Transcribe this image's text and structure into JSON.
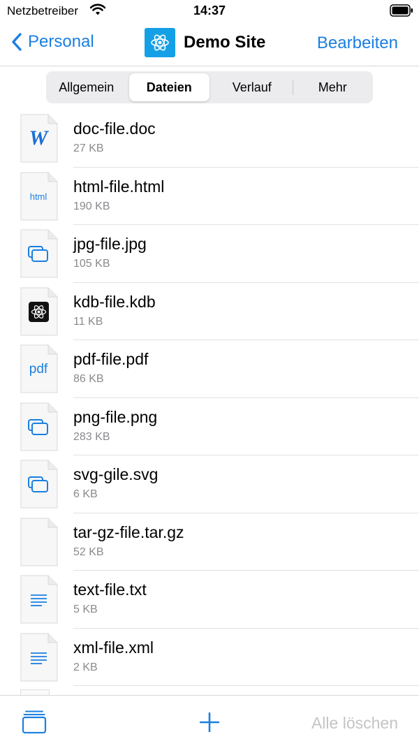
{
  "status_bar": {
    "carrier": "Netzbetreiber",
    "time": "14:37"
  },
  "nav": {
    "back_label": "Personal",
    "title": "Demo Site",
    "edit_label": "Bearbeiten"
  },
  "tabs": [
    {
      "label": "Allgemein",
      "selected": false
    },
    {
      "label": "Dateien",
      "selected": true
    },
    {
      "label": "Verlauf",
      "selected": false
    },
    {
      "label": "Mehr",
      "selected": false
    }
  ],
  "files": [
    {
      "name": "doc-file.doc",
      "size": "27 KB",
      "icon": "word-doc-icon"
    },
    {
      "name": "html-file.html",
      "size": "190 KB",
      "icon": "html-file-icon",
      "icon_text": "html"
    },
    {
      "name": "jpg-file.jpg",
      "size": "105 KB",
      "icon": "image-file-icon"
    },
    {
      "name": "kdb-file.kdb",
      "size": "11 KB",
      "icon": "kdb-file-icon"
    },
    {
      "name": "pdf-file.pdf",
      "size": "86 KB",
      "icon": "pdf-file-icon",
      "icon_text": "pdf"
    },
    {
      "name": "png-file.png",
      "size": "283 KB",
      "icon": "image-file-icon"
    },
    {
      "name": "svg-gile.svg",
      "size": "6 KB",
      "icon": "image-file-icon"
    },
    {
      "name": "tar-gz-file.tar.gz",
      "size": "52 KB",
      "icon": "blank-file-icon"
    },
    {
      "name": "text-file.txt",
      "size": "5 KB",
      "icon": "text-file-icon"
    },
    {
      "name": "xml-file.xml",
      "size": "2 KB",
      "icon": "text-file-icon"
    }
  ],
  "toolbar": {
    "delete_all_label": "Alle löschen"
  },
  "colors": {
    "accent": "#1a7fe0",
    "site_logo": "#14a0e6",
    "disabled": "#c4c4c7",
    "secondary_text": "#8a8a8e"
  }
}
